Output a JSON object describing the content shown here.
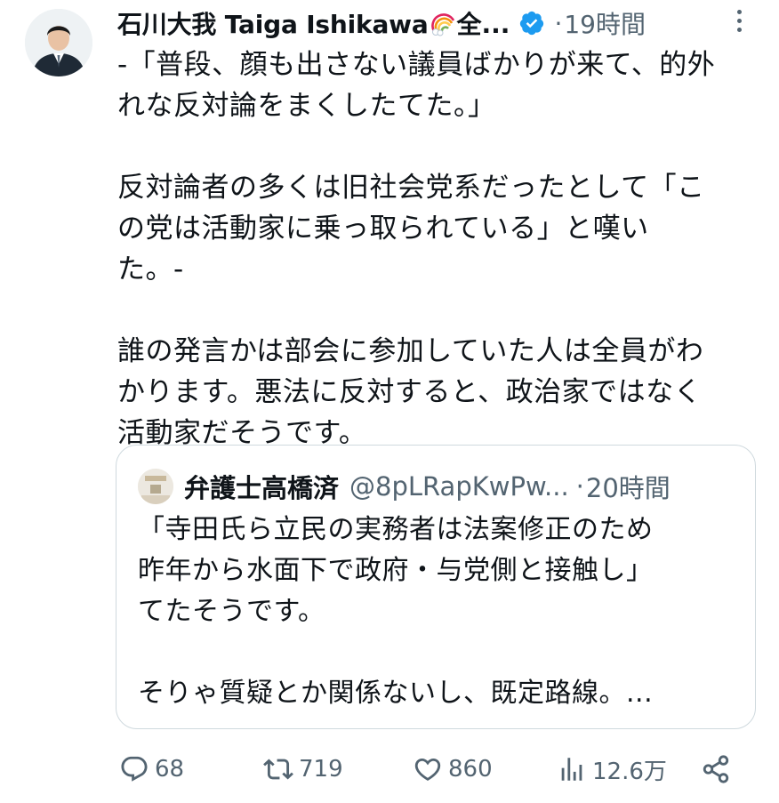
{
  "author": {
    "name": "石川大我 Taiga Ishikawa",
    "name_suffix": "全...",
    "time": "19時間",
    "dot": "·"
  },
  "tweet_lines": [
    "-「普段、顔も出さない議員ばかりが来て、的外",
    "れな反対論をまくしたてた。」",
    "",
    "反対論者の多くは旧社会党系だったとして「こ",
    "の党は活動家に乗っ取られている」と嘆い",
    "た。-",
    "",
    "誰の発言かは部会に参加していた人は全員がわ",
    "かります。悪法に反対すると、政治家ではなく",
    "活動家だそうです。"
  ],
  "quote": {
    "name": "弁護士高橋済",
    "handle": "@8pLRapKwPw...",
    "dot": "·",
    "time": "20時間",
    "lines": [
      "「寺田氏ら立民の実務者は法案修正のため",
      "昨年から水面下で政府・与党側と接触し」",
      "てたそうです。",
      "",
      "そりゃ質疑とか関係ないし、既定路線。..."
    ]
  },
  "actions": {
    "replies": "68",
    "retweets": "719",
    "likes": "860",
    "views": "12.6万"
  },
  "colors": {
    "text": "#0f1419",
    "secondary": "#536471",
    "verified": "#1d9bf0",
    "border": "#cfd9de"
  }
}
